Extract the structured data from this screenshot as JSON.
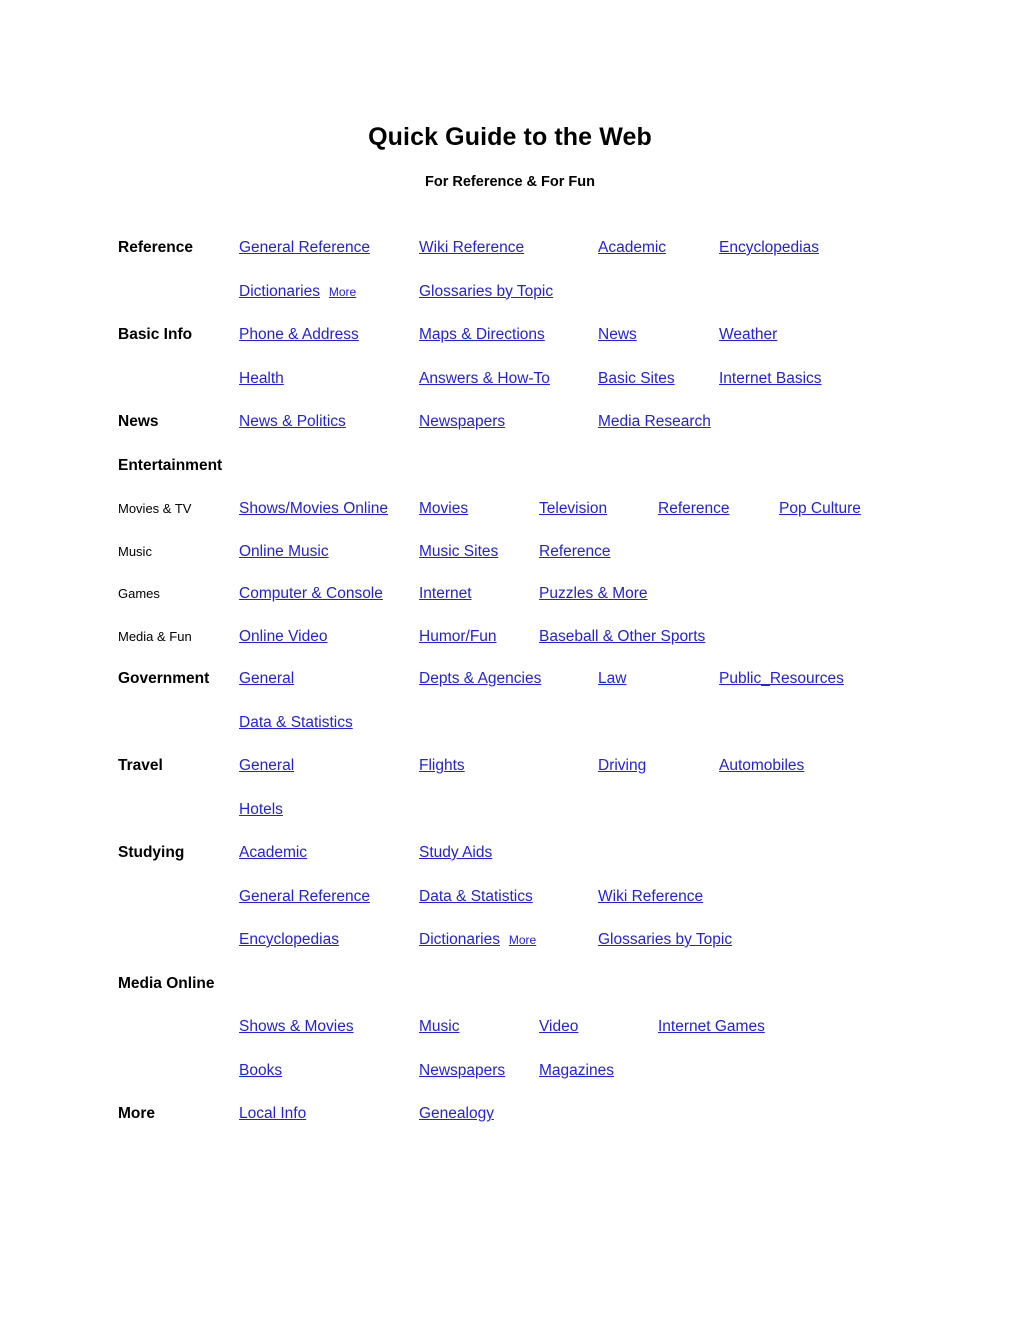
{
  "document": {
    "title": "Quick Guide to the Web",
    "subtitle": "For Reference & For Fun",
    "link_color": "#2222dd",
    "text_color": "#000000",
    "background_color": "#ffffff"
  },
  "sections": {
    "reference": {
      "label": "Reference",
      "row1": {
        "c1": "General Reference",
        "c2": "Wiki Reference",
        "c3": "Academic",
        "c4": "Encyclopedias"
      },
      "row2": {
        "c1": "Dictionaries",
        "c1_more": "More",
        "c2": "Glossaries by Topic"
      }
    },
    "basic_info": {
      "label": "Basic Info",
      "row1": {
        "c1": "Phone & Address",
        "c2": "Maps & Directions",
        "c3": "News",
        "c4": "Weather"
      },
      "row2": {
        "c1": "Health",
        "c2": "Answers & How-To",
        "c3": "Basic Sites",
        "c4": "Internet Basics"
      }
    },
    "news": {
      "label": "News",
      "row1": {
        "c1": "News & Politics",
        "c2": "Newspapers",
        "c3": "Media Research"
      }
    },
    "entertainment": {
      "label": "Entertainment",
      "movies_tv": {
        "label": "Movies & TV",
        "c1": "Shows/Movies Online",
        "c2": "Movies",
        "c3": "Television",
        "c4": "Reference",
        "c5": "Pop Culture"
      },
      "music": {
        "label": "Music",
        "c1": "Online Music",
        "c2": "Music Sites",
        "c3": "Reference"
      },
      "games": {
        "label": "Games",
        "c1": "Computer & Console",
        "c2": "Internet",
        "c3": "Puzzles & More"
      },
      "media_fun": {
        "label": "Media & Fun",
        "c1": "Online Video",
        "c2": "Humor/Fun",
        "c3": "Baseball & Other Sports"
      }
    },
    "government": {
      "label": "Government",
      "row1": {
        "c1": "General",
        "c2": "Depts & Agencies",
        "c3": "Law",
        "c4": "Public_Resources"
      },
      "row2": {
        "c1": "Data & Statistics"
      }
    },
    "travel": {
      "label": "Travel",
      "row1": {
        "c1": "General",
        "c2": "Flights",
        "c3": "Driving",
        "c4": "Automobiles"
      },
      "row2": {
        "c1": "Hotels"
      }
    },
    "studying": {
      "label": "Studying",
      "row1": {
        "c1": "Academic",
        "c2": "Study Aids"
      },
      "row2": {
        "c1": "General Reference",
        "c2": "Data & Statistics",
        "c3": "Wiki Reference"
      },
      "row3": {
        "c1": "Encyclopedias",
        "c2": "Dictionaries",
        "c2_more": "More",
        "c3": "Glossaries by Topic"
      }
    },
    "media_online": {
      "label": "Media Online",
      "row1": {
        "c1": "Shows & Movies",
        "c2": "Music",
        "c3": "Video",
        "c4": "Internet Games"
      },
      "row2": {
        "c1": "Books",
        "c2": "Newspapers",
        "c3": "Magazines"
      }
    },
    "more": {
      "label": "More",
      "row1": {
        "c1": "Local Info",
        "c2": "Genealogy"
      }
    }
  }
}
